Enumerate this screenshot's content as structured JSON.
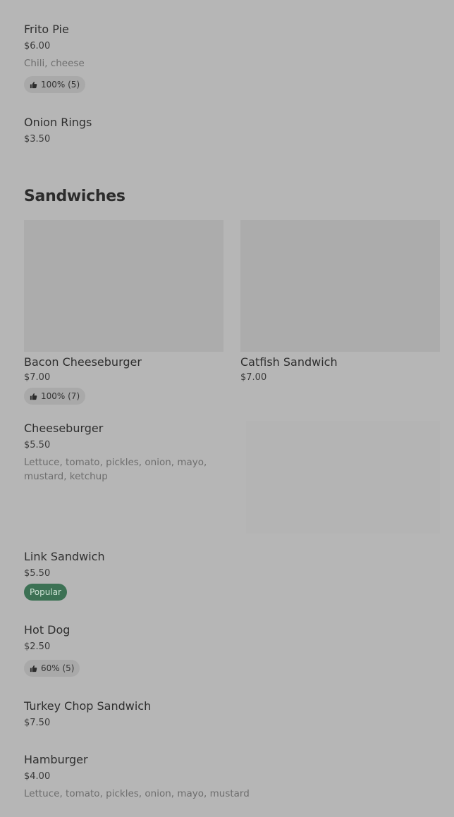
{
  "items_top": [
    {
      "name": "Frito Pie",
      "price": "$6.00",
      "desc": "Chili, cheese",
      "rating": "100% (5)"
    },
    {
      "name": "Onion Rings",
      "price": "$3.50"
    }
  ],
  "sandwiches": {
    "title": "Sandwiches",
    "featured": [
      {
        "name": "Bacon Cheeseburger",
        "price": "$7.00",
        "rating": "100% (7)"
      },
      {
        "name": "Catfish Sandwich",
        "price": "$7.00"
      }
    ],
    "items": [
      {
        "name": "Cheeseburger",
        "price": "$5.50",
        "desc": "Lettuce, tomato, pickles, onion, mayo, mustard, ketchup"
      },
      {
        "name": "Link Sandwich",
        "price": "$5.50",
        "badge": "Popular"
      },
      {
        "name": "Hot Dog",
        "price": "$2.50",
        "rating": "60% (5)"
      },
      {
        "name": "Turkey Chop Sandwich",
        "price": "$7.50"
      },
      {
        "name": "Hamburger",
        "price": "$4.00",
        "desc": "Lettuce, tomato, pickles, onion, mayo, mustard"
      }
    ]
  },
  "colors": {
    "background": "#b6b6b6",
    "badge_popular": "#3c7154"
  },
  "icons": {
    "rating": "thumbs-up-icon"
  }
}
